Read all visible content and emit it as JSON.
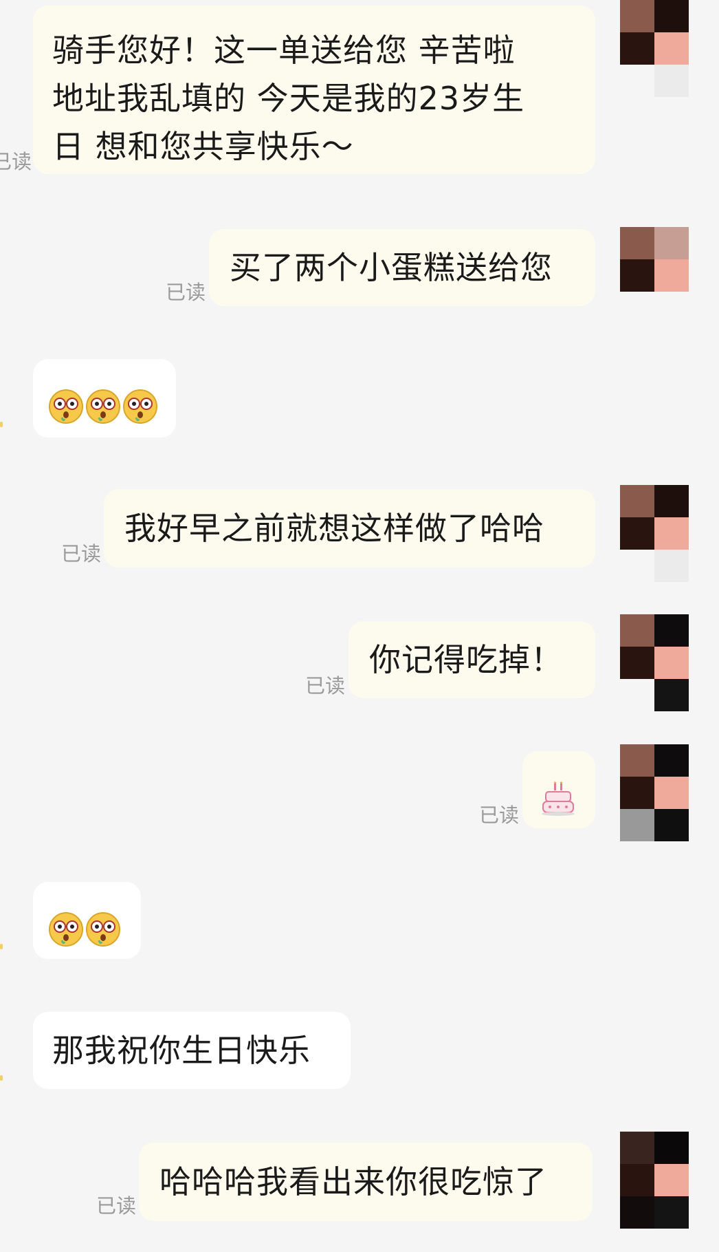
{
  "messages": [
    {
      "id": "m1",
      "side": "mine",
      "text": "骑手您好！这一单送给您 辛苦啦地址我乱填的 今天是我的23岁生日 想和您共享快乐～",
      "read_label": "已读"
    },
    {
      "id": "m2",
      "side": "mine",
      "text": "买了两个小蛋糕送给您",
      "read_label": "已读"
    },
    {
      "id": "m3",
      "side": "theirs",
      "emoji": [
        "flushed-face",
        "flushed-face",
        "flushed-face"
      ]
    },
    {
      "id": "m4",
      "side": "mine",
      "text": "我好早之前就想这样做了哈哈",
      "read_label": "已读"
    },
    {
      "id": "m5",
      "side": "mine",
      "text": "你记得吃掉！",
      "read_label": "已读"
    },
    {
      "id": "m6",
      "side": "mine",
      "emoji": [
        "birthday-cake"
      ],
      "read_label": "已读"
    },
    {
      "id": "m7",
      "side": "theirs",
      "emoji": [
        "flushed-face",
        "flushed-face"
      ]
    },
    {
      "id": "m8",
      "side": "theirs",
      "text": "那我祝你生日快乐"
    },
    {
      "id": "m9",
      "side": "mine",
      "text": "哈哈哈我看出来你很吃惊了",
      "read_label": "已读"
    }
  ],
  "m1_lines": [
    "骑手您好！这一单送给您 辛苦啦",
    "地址我乱填的 今天是我的23岁生",
    "日 想和您共享快乐～"
  ],
  "colors": {
    "mine_bubble": "#fdfbee",
    "theirs_bubble": "#ffffff",
    "background": "#f5f5f5",
    "read_label": "#9a9a9a"
  },
  "avatar": "mosaic-pixelated-avatar"
}
